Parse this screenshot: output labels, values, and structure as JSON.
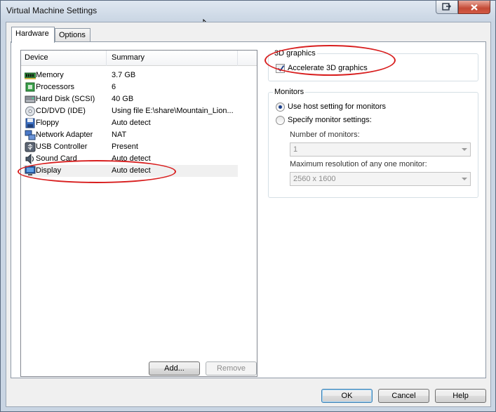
{
  "window": {
    "title": "Virtual Machine Settings"
  },
  "tabs": [
    {
      "label": "Hardware",
      "active": true
    },
    {
      "label": "Options",
      "active": false
    }
  ],
  "device_list": {
    "headers": {
      "device": "Device",
      "summary": "Summary"
    },
    "rows": [
      {
        "icon": "memory-icon",
        "name": "Memory",
        "summary": "3.7 GB"
      },
      {
        "icon": "processor-icon",
        "name": "Processors",
        "summary": "6"
      },
      {
        "icon": "hard-disk-icon",
        "name": "Hard Disk (SCSI)",
        "summary": "40 GB"
      },
      {
        "icon": "cd-dvd-icon",
        "name": "CD/DVD (IDE)",
        "summary": "Using file E:\\share\\Mountain_Lion..."
      },
      {
        "icon": "floppy-icon",
        "name": "Floppy",
        "summary": "Auto detect"
      },
      {
        "icon": "network-adapter-icon",
        "name": "Network Adapter",
        "summary": "NAT"
      },
      {
        "icon": "usb-icon",
        "name": "USB Controller",
        "summary": "Present"
      },
      {
        "icon": "sound-card-icon",
        "name": "Sound Card",
        "summary": "Auto detect"
      },
      {
        "icon": "display-icon",
        "name": "Display",
        "summary": "Auto detect",
        "selected": true
      }
    ],
    "add_button": "Add...",
    "remove_button": "Remove"
  },
  "graphics": {
    "group_title": "3D graphics",
    "accelerate_label": "Accelerate 3D graphics",
    "accelerate_checked": true
  },
  "monitors": {
    "group_title": "Monitors",
    "use_host_label": "Use host setting for monitors",
    "use_host_selected": true,
    "specify_label": "Specify monitor settings:",
    "number_label": "Number of monitors:",
    "number_value": "1",
    "max_res_label": "Maximum resolution of any one monitor:",
    "max_res_value": "2560 x 1600"
  },
  "footer": {
    "ok": "OK",
    "cancel": "Cancel",
    "help": "Help"
  },
  "colors": {
    "annotation": "#d81e1e",
    "selection": "#f0f0f0"
  }
}
